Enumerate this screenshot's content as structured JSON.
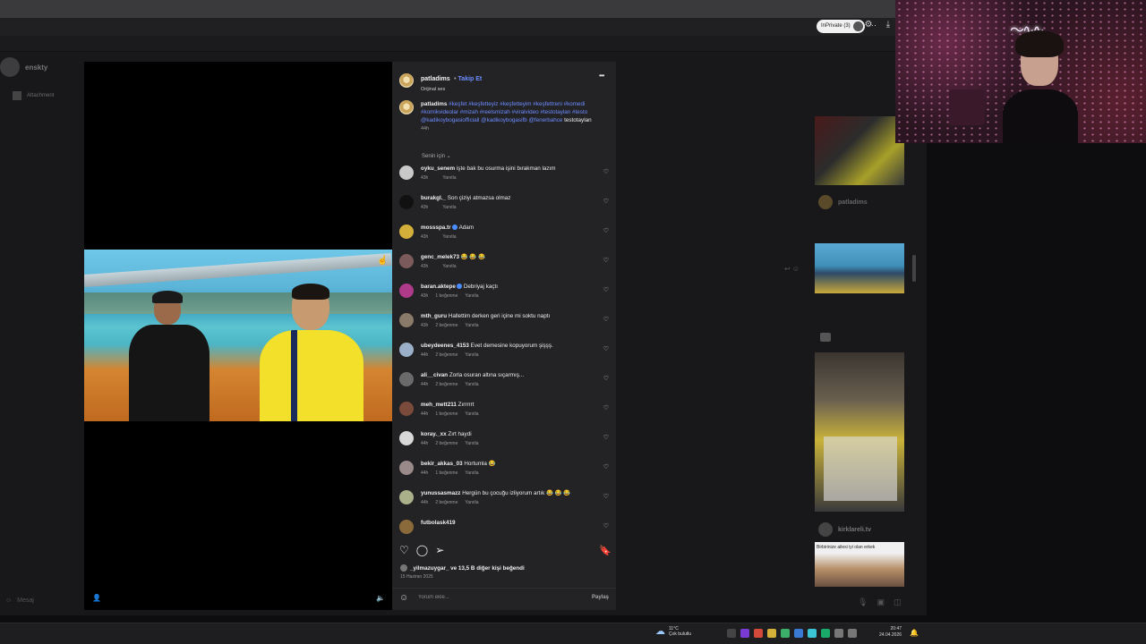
{
  "browser": {
    "inprivate_label": "InPrivate (3)"
  },
  "background_app": {
    "username": "enskty",
    "attachment_label": "Attachment",
    "message_placeholder": "Mesaj",
    "side_feed": [
      {
        "username": "patladims"
      },
      {
        "username": "kirklareli.tv",
        "caption": "Birbirinize ailesi iyi olan erkek"
      }
    ]
  },
  "post": {
    "author": "patladims",
    "follow_label": "Takip Et",
    "audio": "Orijinal ses",
    "caption": {
      "username": "patladims",
      "hashtags": "#keşfet #keşfetteyiz #keşfetteyim #keşfettreni #komedi #komikvideolar #mizah #reelsmizah #viralvideo #testotaylan #testo @kadikoybogasiofficiall @kadikoybogasifb @fenerbahce",
      "tail": " testotaylan",
      "time": "44h"
    },
    "sort_label": "Senin için ⌄",
    "comments": [
      {
        "user": "oyku_senem",
        "verified": false,
        "text": "işte bak bu osurma işini bırakman lazım",
        "time": "43h",
        "likes": "",
        "reply": "Yanıtla",
        "avatar": "#c9c9c9"
      },
      {
        "user": "burakgl._",
        "verified": false,
        "text": "Son çiziyi atmazsa olmaz",
        "time": "43h",
        "likes": "",
        "reply": "Yanıtla",
        "avatar": "#111111"
      },
      {
        "user": "mossspa.tr",
        "verified": true,
        "text": "Adam",
        "time": "43h",
        "likes": "",
        "reply": "Yanıtla",
        "avatar": "#d4b03a"
      },
      {
        "user": "genc_melek73",
        "verified": false,
        "text": "😂 😂 😂",
        "time": "43h",
        "likes": "",
        "reply": "Yanıtla",
        "avatar": "#7a5a5a"
      },
      {
        "user": "baran.aktepe",
        "verified": true,
        "text": "Debriyaj kaçtı",
        "time": "43h",
        "likes": "1 beğenme",
        "reply": "Yanıtla",
        "avatar": "#b03a8a"
      },
      {
        "user": "mth_guru",
        "verified": false,
        "text": "Hallettim derken geri içine mi soktu naptı",
        "time": "43h",
        "likes": "2 beğenme",
        "reply": "Yanıtla",
        "avatar": "#8a7a6a"
      },
      {
        "user": "ubeydeenes_4153",
        "verified": false,
        "text": "Evet demesine kopuyorum şişşş.",
        "time": "44h",
        "likes": "2 beğenme",
        "reply": "Yanıtla",
        "avatar": "#9ab0c8"
      },
      {
        "user": "ali__civan",
        "verified": false,
        "text": "Zorla osuran altına sıçarmış...",
        "time": "44h",
        "likes": "2 beğenme",
        "reply": "Yanıtla",
        "avatar": "#6a6a6a"
      },
      {
        "user": "meh_mett211",
        "verified": false,
        "text": "Zırrrrrt",
        "time": "44h",
        "likes": "1 beğenme",
        "reply": "Yanıtla",
        "avatar": "#7a4a3a"
      },
      {
        "user": "koray._xx",
        "verified": false,
        "text": "Zırt haydi",
        "time": "44h",
        "likes": "2 beğenme",
        "reply": "Yanıtla",
        "avatar": "#d8d8d8"
      },
      {
        "user": "bekir_akkas_03",
        "verified": false,
        "text": "Hortumla 😂",
        "time": "44h",
        "likes": "1 beğenme",
        "reply": "Yanıtla",
        "avatar": "#9a8a8a"
      },
      {
        "user": "yunussasmazz",
        "verified": false,
        "text": "Hergün bu çocuğu izliyorum artık 😂 😂 😂",
        "time": "44h",
        "likes": "2 beğenme",
        "reply": "Yanıtla",
        "avatar": "#aab08a"
      },
      {
        "user": "futbolask419",
        "verified": false,
        "text": "",
        "time": "",
        "likes": "",
        "reply": "",
        "avatar": "#8a6a3a"
      }
    ],
    "likes_text": "_yilmazuygar_ ve 13,5 B diğer kişi beğendi",
    "date": "15 Haziran 2025",
    "comment_placeholder": "Yorum ekle...",
    "post_button": "Paylaş"
  },
  "taskbar": {
    "weather_temp": "11°C",
    "weather_desc": "Çok bulutlu",
    "time": "20:47",
    "date": "24.04.2026"
  }
}
